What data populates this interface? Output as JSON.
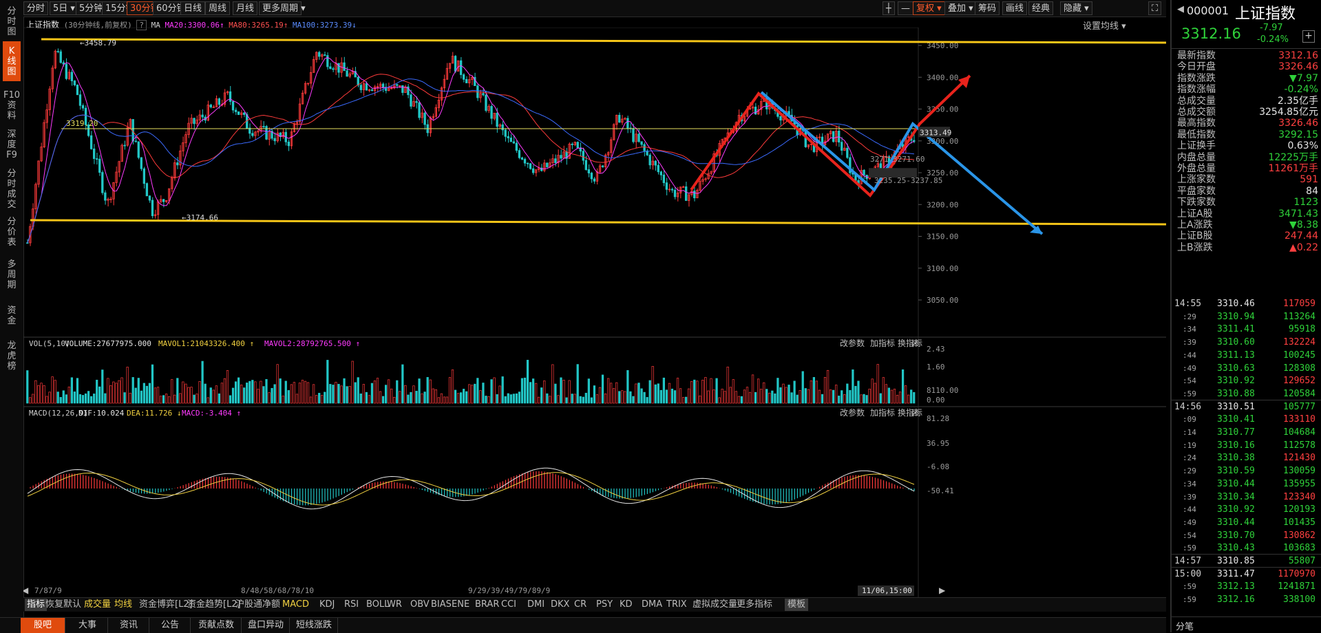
{
  "left_nav": [
    "分\n时\n图",
    "K\n线\n图",
    "F10\n资\n料",
    "深\n度\nF9",
    "分\n时\n成\n交",
    "分\n价\n表",
    "多\n周\n期",
    "资\n金",
    "龙\n虎\n榜"
  ],
  "toolbar": {
    "periods": [
      "分时",
      "5日",
      "5分钟",
      "15分钟",
      "30分钟",
      "60分钟",
      "日线",
      "周线",
      "月线",
      "更多周期"
    ],
    "active_period": "30分钟",
    "right_buttons": [
      "复权",
      "叠加",
      "筹码",
      "画线",
      "经典",
      "隐藏"
    ]
  },
  "chart_header": {
    "name": "上证指数",
    "desc": "(30分钟线,前复权)",
    "ma_label": "MA",
    "ma20": "MA20:3300.06",
    "ma80": "MA80:3265.19",
    "ma100": "MA100:3273.39",
    "settings": "设置均线"
  },
  "price_axis": [
    "3450.00",
    "3400.00",
    "3350.00",
    "3300.00",
    "3250.00",
    "3200.00",
    "3150.00",
    "3100.00",
    "3050.00"
  ],
  "annotations": {
    "high": "3458.79",
    "low": "3174.66",
    "level": "3319.20",
    "current_box": "3313.49",
    "mid1": "3271.60",
    "mid2": "3235.25-3237.85"
  },
  "volume_panel": {
    "title": "VOL(5,10)",
    "volume": "VOLUME:27677975.000",
    "mavol1": "MAVOL1:21043326.400",
    "mavol2": "MAVOL2:28792765.500",
    "axis": [
      "2.43",
      "1.60",
      "8110.00",
      "0.00"
    ],
    "buttons": [
      "改参数",
      "加指标",
      "换指标"
    ]
  },
  "macd_panel": {
    "title": "MACD(12,26,9)",
    "dif": "DIF:10.024",
    "dea": "DEA:11.726",
    "macd": "MACD:-3.404",
    "axis": [
      "81.28",
      "36.95",
      "-6.08",
      "-50.41"
    ],
    "buttons": [
      "改参数",
      "加指标",
      "换指标"
    ]
  },
  "x_axis": [
    "7/87/9",
    "8/48/58/68/78/10",
    "9/29/39/49/79/89/9"
  ],
  "x_cursor": "11/06,15:00",
  "indicator_tabs": [
    "指标",
    "恢复默认",
    "成交量",
    "均线",
    "资金博弈[L2]",
    "资金趋势[L2]",
    "沪股通净额",
    "MACD",
    "KDJ",
    "RSI",
    "BOLL",
    "WR",
    "OBV",
    "BIAS",
    "ENE",
    "BRAR",
    "CCI",
    "DMI",
    "DKX",
    "CR",
    "PSY",
    "KD",
    "DMA",
    "TRIX",
    "虚拟成交量",
    "更多指标",
    "模板"
  ],
  "bottom_tabs": [
    "股吧",
    "大事",
    "资讯",
    "公告",
    "贡献点数",
    "盘口异动",
    "短线涨跌"
  ],
  "quote": {
    "code": "000001",
    "name": "上证指数",
    "price": "3312.16",
    "change": "-7.97",
    "pct": "-0.24%",
    "rows": [
      {
        "k": "最新指数",
        "v": "3312.16",
        "c": "red"
      },
      {
        "k": "今日开盘",
        "v": "3326.46",
        "c": "red"
      },
      {
        "k": "指数涨跌",
        "v": "▼7.97",
        "c": "green"
      },
      {
        "k": "指数涨幅",
        "v": "-0.24%",
        "c": "green"
      },
      {
        "k": "总成交量",
        "v": "2.35亿手",
        "c": "white"
      },
      {
        "k": "总成交额",
        "v": "3254.85亿元",
        "c": "white"
      },
      {
        "k": "最高指数",
        "v": "3326.46",
        "c": "red"
      },
      {
        "k": "最低指数",
        "v": "3292.15",
        "c": "green"
      },
      {
        "k": "上证换手",
        "v": "0.63%",
        "c": "white"
      },
      {
        "k": "内盘总量",
        "v": "12225万手",
        "c": "green"
      },
      {
        "k": "外盘总量",
        "v": "11261万手",
        "c": "red"
      },
      {
        "k": "上涨家数",
        "v": "591",
        "c": "red"
      },
      {
        "k": "平盘家数",
        "v": "84",
        "c": "white"
      },
      {
        "k": "下跌家数",
        "v": "1123",
        "c": "green"
      },
      {
        "k": "上证A股",
        "v": "3471.43",
        "c": "green"
      },
      {
        "k": "上A涨跌",
        "v": "▼8.38",
        "c": "green"
      },
      {
        "k": "上证B股",
        "v": "247.44",
        "c": "red"
      },
      {
        "k": "上B涨跌",
        "v": "▲0.22",
        "c": "red"
      }
    ],
    "ticks": [
      {
        "t": "14:55",
        "p": "3310.46",
        "v": "117059",
        "main": true
      },
      {
        "t": "29",
        "p": "3310.94",
        "v": "113264"
      },
      {
        "t": "34",
        "p": "3311.41",
        "v": "95918"
      },
      {
        "t": "39",
        "p": "3310.60",
        "v": "132224"
      },
      {
        "t": "44",
        "p": "3311.13",
        "v": "100245"
      },
      {
        "t": "49",
        "p": "3310.63",
        "v": "128308"
      },
      {
        "t": "54",
        "p": "3310.92",
        "v": "129652"
      },
      {
        "t": "59",
        "p": "3310.88",
        "v": "120584"
      },
      {
        "t": "14:56",
        "p": "3310.51",
        "v": "105777",
        "main": true
      },
      {
        "t": "09",
        "p": "3310.41",
        "v": "133110"
      },
      {
        "t": "14",
        "p": "3310.77",
        "v": "104684"
      },
      {
        "t": "19",
        "p": "3310.16",
        "v": "112578"
      },
      {
        "t": "24",
        "p": "3310.38",
        "v": "121430"
      },
      {
        "t": "29",
        "p": "3310.59",
        "v": "130059"
      },
      {
        "t": "34",
        "p": "3310.44",
        "v": "135955"
      },
      {
        "t": "39",
        "p": "3310.34",
        "v": "123340"
      },
      {
        "t": "44",
        "p": "3310.92",
        "v": "120193"
      },
      {
        "t": "49",
        "p": "3310.44",
        "v": "101435"
      },
      {
        "t": "54",
        "p": "3310.70",
        "v": "130862"
      },
      {
        "t": "59",
        "p": "3310.43",
        "v": "103683"
      },
      {
        "t": "14:57",
        "p": "3310.85",
        "v": "55807",
        "main": true
      },
      {
        "t": "15:00",
        "p": "3311.47",
        "v": "1170970",
        "main": true
      },
      {
        "t": "59",
        "p": "3312.13",
        "v": "1241871"
      },
      {
        "t": "59",
        "p": "3312.16",
        "v": "338100"
      }
    ],
    "footer_tab": "分笔"
  },
  "colors": {
    "up": "#ff3b3b",
    "down": "#22c7c7",
    "ma20": "#ff3bff",
    "ma80": "#ff3b3b",
    "ma100": "#3b6bff",
    "channel": "#f5c518",
    "accent": "#e04b0e"
  }
}
